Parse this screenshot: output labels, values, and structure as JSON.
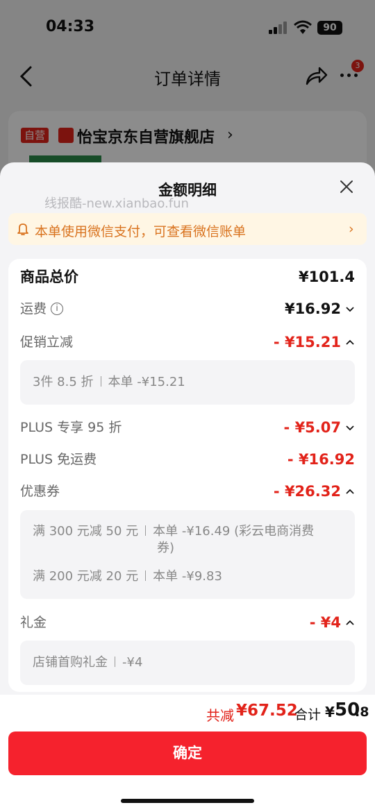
{
  "status_bar": {
    "time": "04:33",
    "battery": "90"
  },
  "nav": {
    "title": "订单详情",
    "badge": "3"
  },
  "store": {
    "tag": "自营",
    "name": "怡宝京东自营旗舰店",
    "arrow": "›"
  },
  "sheet": {
    "title": "金额明细",
    "watermark": "线报酷-new.xianbao.fun",
    "notice": "本单使用微信支付，可查看微信账单"
  },
  "breakdown": {
    "goods_total": {
      "label": "商品总价",
      "value": "¥101.4"
    },
    "shipping": {
      "label": "运费",
      "value": "¥16.92"
    },
    "promo": {
      "label": "促销立减",
      "value": "- ¥15.21",
      "detail_left": "3件 8.5 折",
      "detail_right": "本单 -¥15.21"
    },
    "plus95": {
      "label": "PLUS 专享 95 折",
      "value": "- ¥5.07"
    },
    "plus_free_ship": {
      "label": "PLUS 免运费",
      "value": "- ¥16.92"
    },
    "coupon": {
      "label": "优惠券",
      "value": "- ¥26.32",
      "line1_left": "满 300 元减 50 元",
      "line1_right": "本单 -¥16.49 (彩云电商消费",
      "line1_wrap": "券)",
      "line2_left": "满 200 元减 20 元",
      "line2_right": "本单 -¥9.83"
    },
    "gift": {
      "label": "礼金",
      "value": "- ¥4",
      "detail_left": "店铺首购礼金",
      "detail_right": "-¥4"
    }
  },
  "footer": {
    "saved_label": "共减",
    "saved_amount": "¥67.52",
    "sum_label": "合计",
    "sum_currency": "¥",
    "sum_integer": "50",
    "sum_decimal": ".8",
    "confirm": "确定"
  },
  "colors": {
    "accent": "#e2231a",
    "button": "#f5222d",
    "notice_text": "#d9731f",
    "notice_bg": "#fff6e4"
  }
}
